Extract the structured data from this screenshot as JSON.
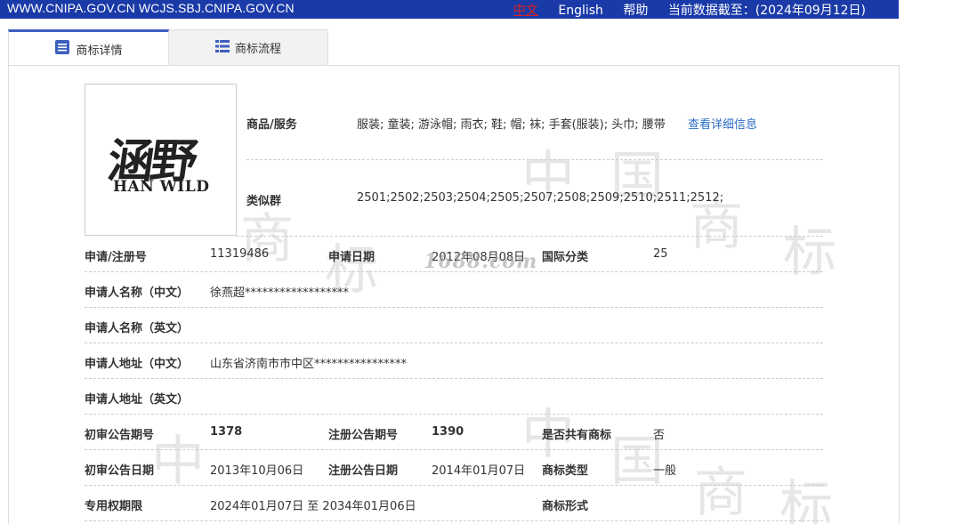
{
  "topbar": {
    "sites": "WWW.CNIPA.GOV.CN WCJS.SBJ.CNIPA.GOV.CN",
    "lang_zh": "中文",
    "lang_en": "English",
    "help": "帮助",
    "data_date": "当前数据截至：(2024年09月12日)"
  },
  "tabs": [
    {
      "label": "商标详情",
      "icon": "document-list-icon",
      "active": true
    },
    {
      "label": "商标流程",
      "icon": "grid-list-icon",
      "active": false
    }
  ],
  "logo": {
    "text_cn": "涵野",
    "text_en": "HAN WILD"
  },
  "watermark_site": "1688.com",
  "goods_services": {
    "label": "商品/服务",
    "value": "服装; 童装; 游泳帽; 雨衣; 鞋; 帽; 袜; 手套(服装); 头巾; 腰带",
    "link": "查看详细信息"
  },
  "similar_group": {
    "label": "类似群",
    "value": "2501;2502;2503;2504;2505;2507;2508;2509;2510;2511;2512;"
  },
  "fields": {
    "reg_no": {
      "label": "申请/注册号",
      "value": "11319486"
    },
    "app_date": {
      "label": "申请日期",
      "value": "2012年08月08日"
    },
    "intl_class": {
      "label": "国际分类",
      "value": "25"
    },
    "applicant_cn": {
      "label": "申请人名称（中文）",
      "value": "徐燕超******************"
    },
    "applicant_en": {
      "label": "申请人名称（英文）",
      "value": ""
    },
    "address_cn": {
      "label": "申请人地址（中文）",
      "value": "山东省济南市市中区****************"
    },
    "address_en": {
      "label": "申请人地址（英文）",
      "value": ""
    },
    "prelim_issue": {
      "label": "初审公告期号",
      "value": "1378"
    },
    "reg_issue": {
      "label": "注册公告期号",
      "value": "1390"
    },
    "shared": {
      "label": "是否共有商标",
      "value": "否"
    },
    "prelim_date": {
      "label": "初审公告日期",
      "value": "2013年10月06日"
    },
    "reg_date": {
      "label": "注册公告日期",
      "value": "2014年01月07日"
    },
    "tm_type": {
      "label": "商标类型",
      "value": "一般"
    },
    "term": {
      "label": "专用权期限",
      "value": "2024年01月07日 至 2034年01月06日"
    },
    "tm_form": {
      "label": "商标形式",
      "value": ""
    }
  }
}
